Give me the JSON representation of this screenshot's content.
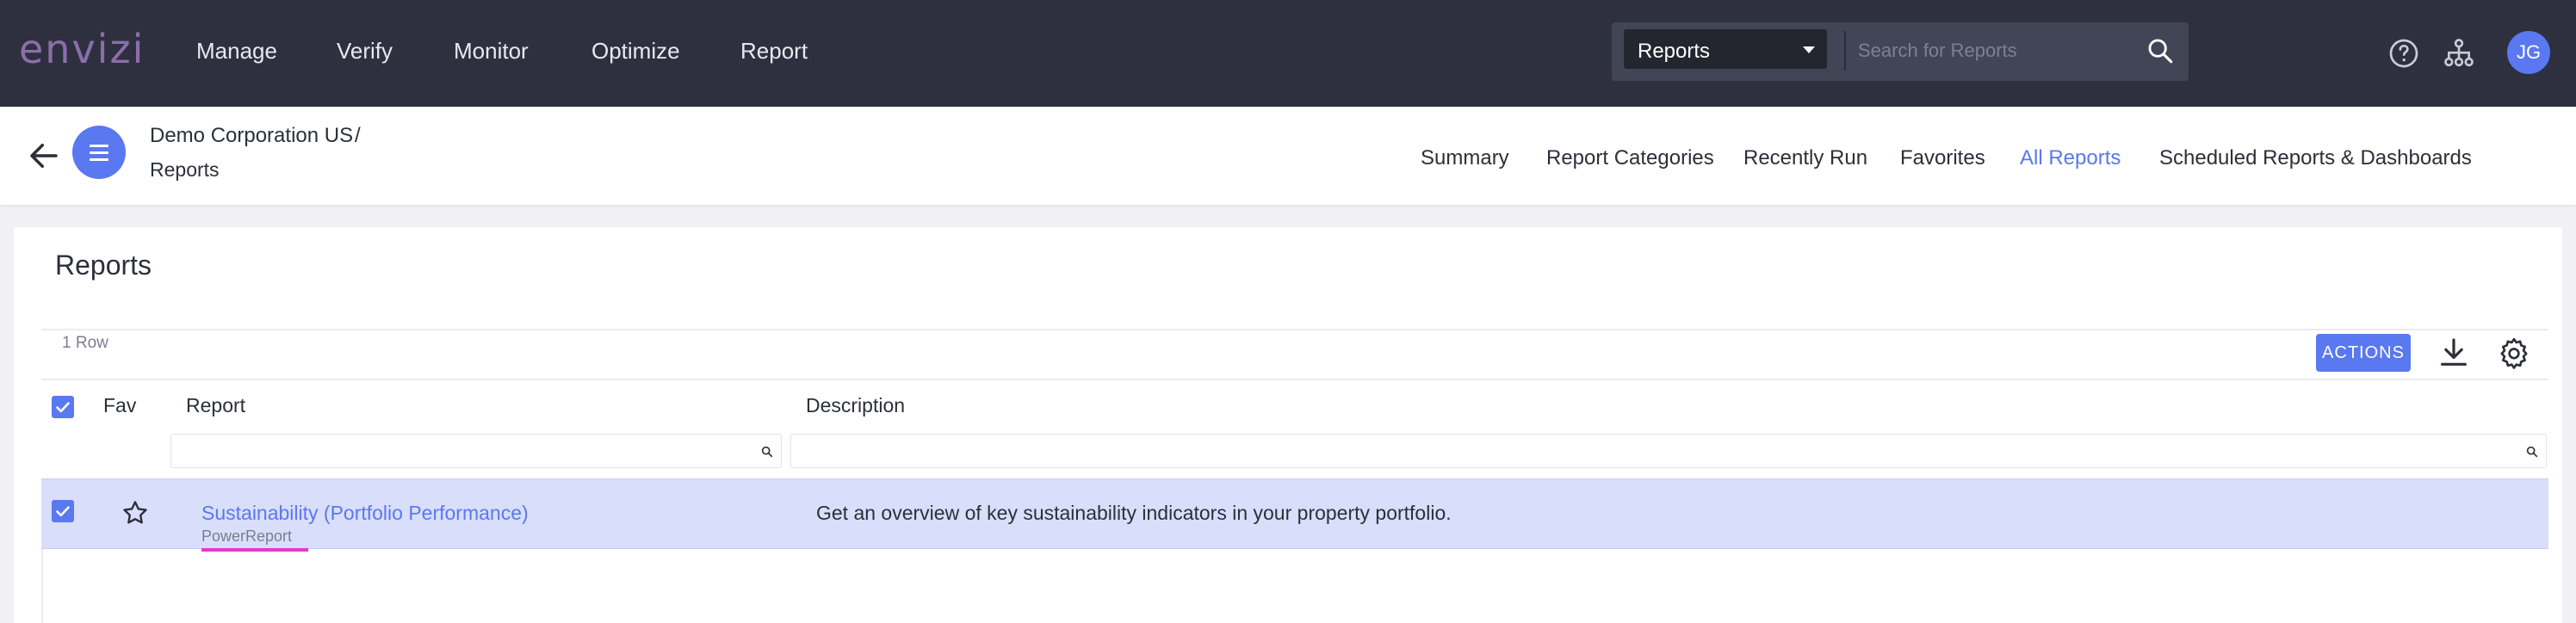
{
  "app": {
    "logo_text": "envizi",
    "brand_color": "#5a78f0",
    "accent_link": "#5a78f0",
    "highlight_row": "#d9defa"
  },
  "topnav": {
    "items": [
      {
        "label": "Manage"
      },
      {
        "label": "Verify"
      },
      {
        "label": "Monitor"
      },
      {
        "label": "Optimize"
      },
      {
        "label": "Report"
      }
    ],
    "search": {
      "scope": "Reports",
      "placeholder": "Search for Reports"
    },
    "user_initials": "JG",
    "icons": [
      "help-icon",
      "org-hierarchy-icon",
      "search-icon"
    ]
  },
  "subheader": {
    "breadcrumb": {
      "parent": "Demo Corporation US",
      "separator": "/",
      "current": "Reports"
    },
    "tabs": [
      {
        "label": "Summary",
        "active": false
      },
      {
        "label": "Report Categories",
        "active": false
      },
      {
        "label": "Recently Run",
        "active": false
      },
      {
        "label": "Favorites",
        "active": false
      },
      {
        "label": "All Reports",
        "active": true
      },
      {
        "label": "Scheduled Reports & Dashboards",
        "active": false
      }
    ]
  },
  "main": {
    "title": "Reports",
    "row_count": "1 Row",
    "actions_label": "ACTIONS",
    "columns": {
      "fav": "Fav",
      "report": "Report",
      "description": "Description"
    },
    "rows": [
      {
        "selected": true,
        "favorite": false,
        "name": "Sustainability (Portfolio Performance)",
        "type": "PowerReport",
        "description": "Get an overview of key sustainability indicators in your property portfolio."
      }
    ]
  }
}
